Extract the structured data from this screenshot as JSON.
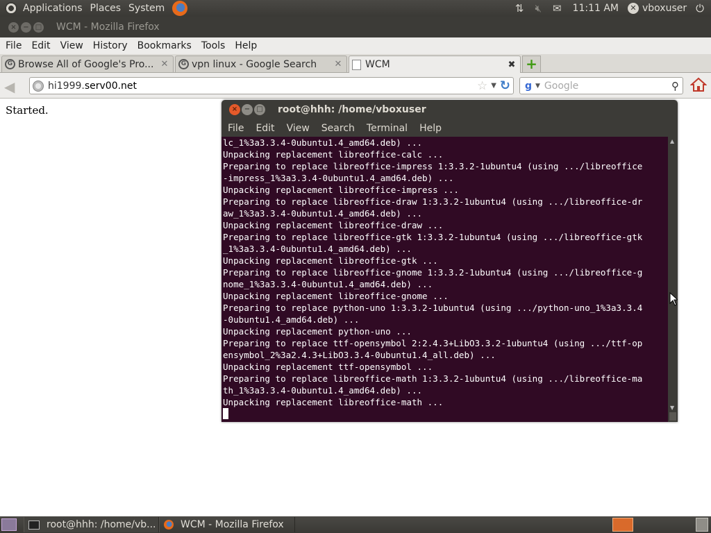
{
  "top_panel": {
    "menus": [
      "Applications",
      "Places",
      "System"
    ],
    "clock": "11:11 AM",
    "username": "vboxuser"
  },
  "firefox": {
    "window_title": "WCM - Mozilla Firefox",
    "menus": [
      "File",
      "Edit",
      "View",
      "History",
      "Bookmarks",
      "Tools",
      "Help"
    ],
    "tabs": [
      {
        "label": "Browse All of Google's Pro...",
        "icon": "google-icon"
      },
      {
        "label": "vpn linux - Google Search",
        "icon": "google-icon"
      },
      {
        "label": "WCM",
        "icon": "blank-page-icon"
      }
    ],
    "url_prefix": "hi1999.",
    "url_host": "serv00.net",
    "search_placeholder": "Google",
    "page_text": "Started."
  },
  "terminal": {
    "title": "root@hhh: /home/vboxuser",
    "menus": [
      "File",
      "Edit",
      "View",
      "Search",
      "Terminal",
      "Help"
    ],
    "lines": [
      "lc_1%3a3.3.4-0ubuntu1.4_amd64.deb) ...",
      "Unpacking replacement libreoffice-calc ...",
      "Preparing to replace libreoffice-impress 1:3.3.2-1ubuntu4 (using .../libreoffice",
      "-impress_1%3a3.3.4-0ubuntu1.4_amd64.deb) ...",
      "Unpacking replacement libreoffice-impress ...",
      "Preparing to replace libreoffice-draw 1:3.3.2-1ubuntu4 (using .../libreoffice-dr",
      "aw_1%3a3.3.4-0ubuntu1.4_amd64.deb) ...",
      "Unpacking replacement libreoffice-draw ...",
      "Preparing to replace libreoffice-gtk 1:3.3.2-1ubuntu4 (using .../libreoffice-gtk",
      "_1%3a3.3.4-0ubuntu1.4_amd64.deb) ...",
      "Unpacking replacement libreoffice-gtk ...",
      "Preparing to replace libreoffice-gnome 1:3.3.2-1ubuntu4 (using .../libreoffice-g",
      "nome_1%3a3.3.4-0ubuntu1.4_amd64.deb) ...",
      "Unpacking replacement libreoffice-gnome ...",
      "Preparing to replace python-uno 1:3.3.2-1ubuntu4 (using .../python-uno_1%3a3.3.4",
      "-0ubuntu1.4_amd64.deb) ...",
      "Unpacking replacement python-uno ...",
      "Preparing to replace ttf-opensymbol 2:2.4.3+LibO3.3.2-1ubuntu4 (using .../ttf-op",
      "ensymbol_2%3a2.4.3+LibO3.3.4-0ubuntu1.4_all.deb) ...",
      "Unpacking replacement ttf-opensymbol ...",
      "Preparing to replace libreoffice-math 1:3.3.2-1ubuntu4 (using .../libreoffice-ma",
      "th_1%3a3.3.4-0ubuntu1.4_amd64.deb) ...",
      "Unpacking replacement libreoffice-math ..."
    ]
  },
  "taskbar": {
    "tasks": [
      "root@hhh: /home/vb...",
      "WCM - Mozilla Firefox"
    ]
  }
}
